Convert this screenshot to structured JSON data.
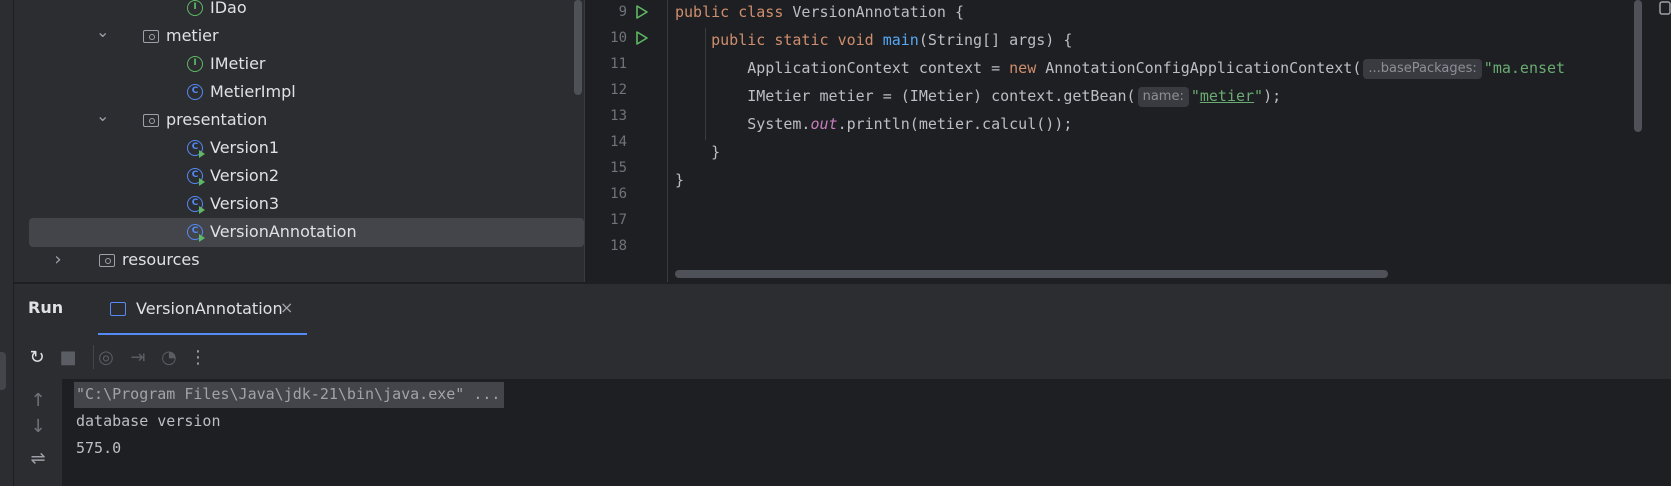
{
  "project_tree": {
    "items": [
      {
        "type": "interface",
        "label": "IDao",
        "indent": 3,
        "chevron": ""
      },
      {
        "type": "folder",
        "label": "metier",
        "indent": 2,
        "chevron": "expanded"
      },
      {
        "type": "interface",
        "label": "IMetier",
        "indent": 3,
        "chevron": ""
      },
      {
        "type": "class",
        "label": "MetierImpl",
        "indent": 3,
        "chevron": ""
      },
      {
        "type": "folder",
        "label": "presentation",
        "indent": 2,
        "chevron": "expanded"
      },
      {
        "type": "runnable-class",
        "label": "Version1",
        "indent": 3,
        "chevron": ""
      },
      {
        "type": "runnable-class",
        "label": "Version2",
        "indent": 3,
        "chevron": ""
      },
      {
        "type": "runnable-class",
        "label": "Version3",
        "indent": 3,
        "chevron": ""
      },
      {
        "type": "runnable-class",
        "label": "VersionAnnotation",
        "indent": 3,
        "chevron": "",
        "selected": true
      },
      {
        "type": "folder",
        "label": "resources",
        "indent": 1,
        "chevron": "collapsed"
      }
    ]
  },
  "editor": {
    "line_numbers": [
      "9",
      "10",
      "11",
      "12",
      "13",
      "14",
      "15",
      "16",
      "17",
      "18"
    ],
    "run_gutter_lines": [
      "9",
      "10"
    ],
    "code": {
      "l9_kw1": "public",
      "l9_kw2": "class",
      "l9_rest": " VersionAnnotation {",
      "l10_kw1": "public",
      "l10_kw2": "static",
      "l10_kw3": "void",
      "l10_fn": "main",
      "l10_rest": "(String[] args) {",
      "l11_a": "ApplicationContext context = ",
      "l11_kw": "new",
      "l11_b": " AnnotationConfigApplicationContext(",
      "l11_hint": "...basePackages:",
      "l11_str": "\"ma.enset",
      "l12_a": "IMetier metier = (IMetier) context.getBean(",
      "l12_hint": "name:",
      "l12_q1": "\"",
      "l12_str": "metier",
      "l12_q2": "\"",
      "l12_b": ");",
      "l13_a": "System.",
      "l13_field": "out",
      "l13_b": ".println(metier.calcul());",
      "l14": "}",
      "l15": "}"
    }
  },
  "run_panel": {
    "title": "Run",
    "tab_label": "VersionAnnotation",
    "tab_close": "×",
    "toolbar": [
      {
        "name": "rerun-icon",
        "glyph": "↻",
        "disabled": false
      },
      {
        "name": "stop-icon",
        "glyph": "■",
        "disabled": true
      },
      {
        "name": "camera-icon",
        "glyph": "◎",
        "disabled": true
      },
      {
        "name": "exit-icon",
        "glyph": "⇥",
        "disabled": true
      },
      {
        "name": "gauge-icon",
        "glyph": "◔",
        "disabled": true
      },
      {
        "name": "more-options-icon",
        "glyph": "⋮",
        "disabled": false
      }
    ],
    "console_lines": [
      {
        "text": "\"C:\\Program Files\\Java\\jdk-21\\bin\\java.exe\" ...",
        "cmd": true
      },
      {
        "text": "database version",
        "cmd": false
      },
      {
        "text": "575.0",
        "cmd": false
      }
    ],
    "gutter_buttons": [
      {
        "name": "scroll-up-icon",
        "glyph": "↑"
      },
      {
        "name": "scroll-down-icon",
        "glyph": "↓"
      },
      {
        "name": "soft-wrap-icon",
        "glyph": "⇌"
      }
    ]
  },
  "colors": {
    "accent": "#548af7",
    "interface_icon": "#5fb865",
    "run_icon": "#5fb865",
    "keyword": "#cf8e6d",
    "string": "#6aab73",
    "function": "#56a8f5"
  }
}
